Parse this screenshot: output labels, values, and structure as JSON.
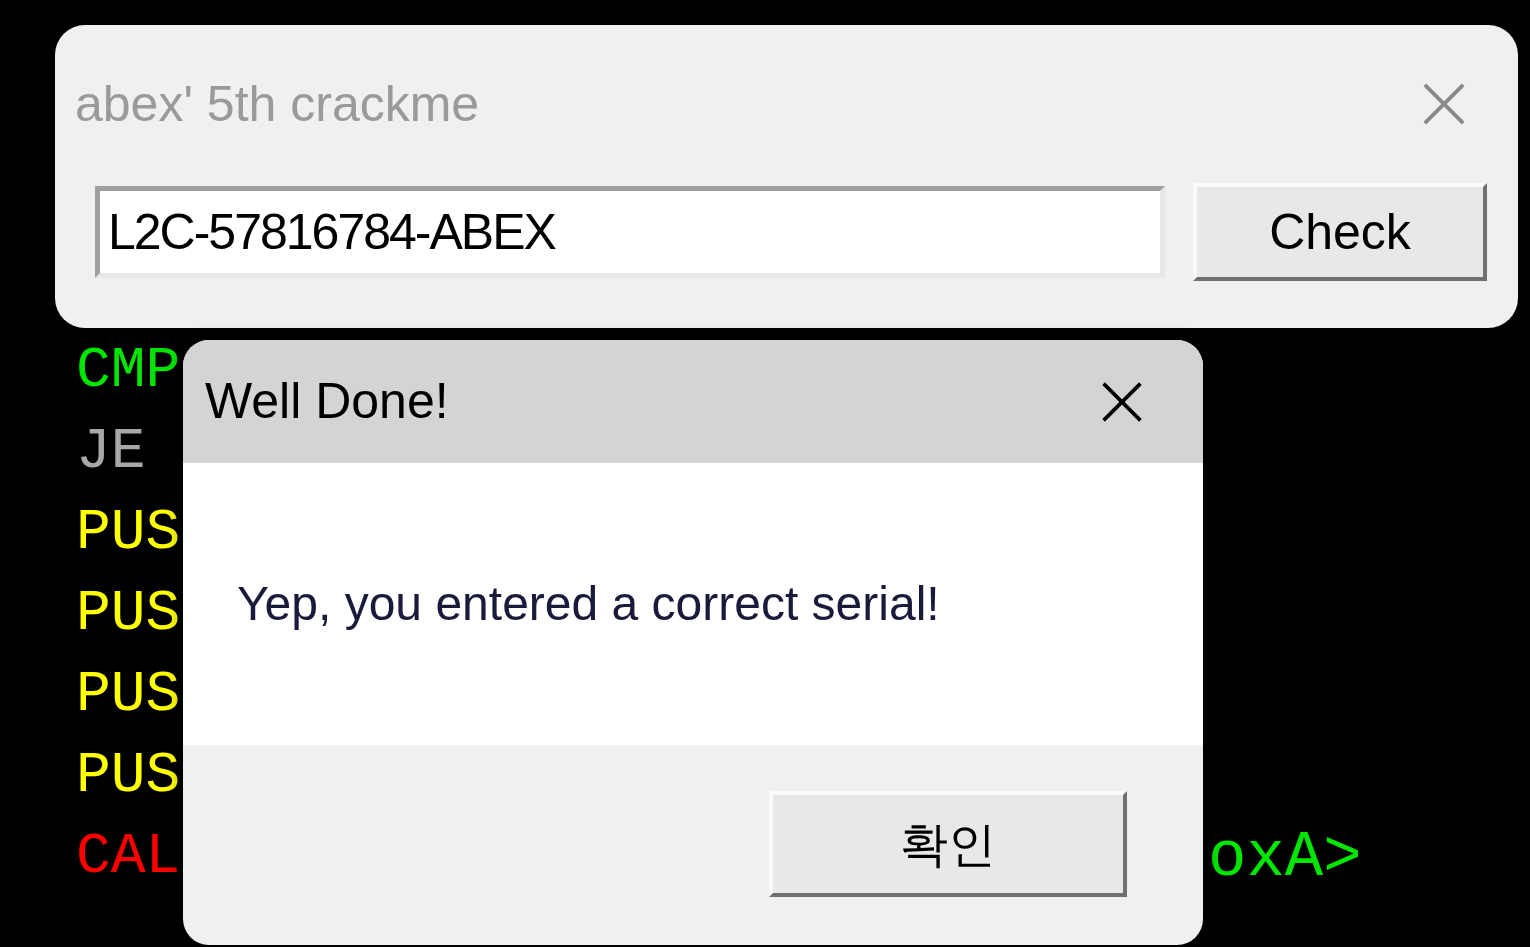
{
  "code_lines": [
    {
      "text": "CMP",
      "color": "#00e600"
    },
    {
      "text": "JE",
      "color": "#a8a8a8"
    },
    {
      "text": "PUS",
      "color": "#ffff00"
    },
    {
      "text": "PUS",
      "color": "#ffff00"
    },
    {
      "text": "PUS",
      "color": "#ffff00"
    },
    {
      "text": "PUS",
      "color": "#ffff00"
    },
    {
      "text": "CAL",
      "color": "#ff0000"
    }
  ],
  "code_fragment": {
    "text": "oxA>",
    "color": "#00e600"
  },
  "main_window": {
    "title": "abex' 5th crackme",
    "serial": "L2C-57816784-ABEX",
    "button": "Check"
  },
  "message_box": {
    "title": "Well Done!",
    "message": "Yep, you entered a correct serial!",
    "button": "확인"
  }
}
